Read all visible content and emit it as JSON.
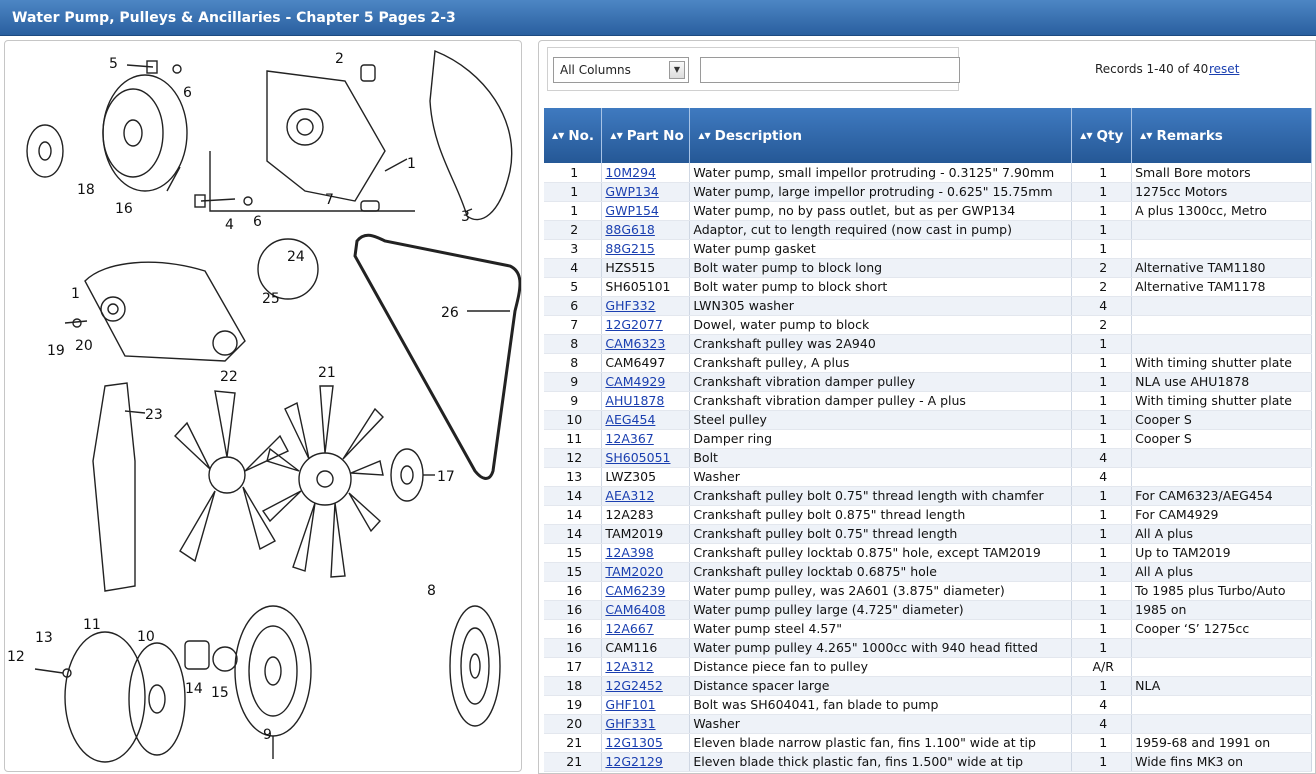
{
  "title": "Water Pump, Pulleys & Ancillaries - Chapter 5 Pages 2-3",
  "diagram": {
    "labels": [
      "5",
      "6",
      "2",
      "18",
      "16",
      "4",
      "6",
      "7",
      "1",
      "3",
      "24",
      "25",
      "1",
      "19",
      "20",
      "26",
      "22",
      "21",
      "23",
      "17",
      "8",
      "13",
      "11",
      "10",
      "12",
      "14",
      "15",
      "9"
    ]
  },
  "filter": {
    "column_select": "All Columns",
    "search_value": "",
    "records_text": "Records 1-40 of 40",
    "reset_label": "reset"
  },
  "table": {
    "headers": [
      "No.",
      "Part No",
      "Description",
      "Qty",
      "Remarks"
    ],
    "rows": [
      {
        "no": "1",
        "part": "10M294",
        "link": true,
        "desc": "Water pump, small impellor protruding - 0.3125\" 7.90mm",
        "qty": "1",
        "rem": "Small Bore motors"
      },
      {
        "no": "1",
        "part": "GWP134",
        "link": true,
        "desc": "Water pump, large impellor protruding - 0.625\" 15.75mm",
        "qty": "1",
        "rem": "1275cc Motors"
      },
      {
        "no": "1",
        "part": "GWP154",
        "link": true,
        "desc": "Water pump, no by pass outlet, but as per GWP134",
        "qty": "1",
        "rem": "A plus 1300cc, Metro"
      },
      {
        "no": "2",
        "part": "88G618",
        "link": true,
        "desc": "Adaptor, cut to length required (now cast in pump)",
        "qty": "1",
        "rem": ""
      },
      {
        "no": "3",
        "part": "88G215",
        "link": true,
        "desc": "Water pump gasket",
        "qty": "1",
        "rem": ""
      },
      {
        "no": "4",
        "part": "HZS515",
        "link": false,
        "desc": "Bolt water pump to block long",
        "qty": "2",
        "rem": "Alternative TAM1180"
      },
      {
        "no": "5",
        "part": "SH605101",
        "link": false,
        "desc": "Bolt water pump to block short",
        "qty": "2",
        "rem": "Alternative TAM1178"
      },
      {
        "no": "6",
        "part": "GHF332",
        "link": true,
        "desc": "LWN305 washer",
        "qty": "4",
        "rem": ""
      },
      {
        "no": "7",
        "part": "12G2077",
        "link": true,
        "desc": "Dowel, water pump to block",
        "qty": "2",
        "rem": ""
      },
      {
        "no": "8",
        "part": "CAM6323",
        "link": true,
        "desc": "Crankshaft pulley was 2A940",
        "qty": "1",
        "rem": ""
      },
      {
        "no": "8",
        "part": "CAM6497",
        "link": false,
        "desc": "Crankshaft pulley, A plus",
        "qty": "1",
        "rem": "With timing shutter plate"
      },
      {
        "no": "9",
        "part": "CAM4929",
        "link": true,
        "desc": "Crankshaft vibration damper pulley",
        "qty": "1",
        "rem": "NLA use AHU1878"
      },
      {
        "no": "9",
        "part": "AHU1878",
        "link": true,
        "desc": "Crankshaft vibration damper pulley - A plus",
        "qty": "1",
        "rem": "With timing shutter plate"
      },
      {
        "no": "10",
        "part": "AEG454",
        "link": true,
        "desc": "Steel pulley",
        "qty": "1",
        "rem": "Cooper S"
      },
      {
        "no": "11",
        "part": "12A367",
        "link": true,
        "desc": "Damper ring",
        "qty": "1",
        "rem": "Cooper S"
      },
      {
        "no": "12",
        "part": "SH605051",
        "link": true,
        "desc": "Bolt",
        "qty": "4",
        "rem": ""
      },
      {
        "no": "13",
        "part": "LWZ305",
        "link": false,
        "desc": "Washer",
        "qty": "4",
        "rem": ""
      },
      {
        "no": "14",
        "part": "AEA312",
        "link": true,
        "desc": "Crankshaft pulley bolt 0.75\" thread length with chamfer",
        "qty": "1",
        "rem": "For CAM6323/AEG454"
      },
      {
        "no": "14",
        "part": "12A283",
        "link": false,
        "desc": "Crankshaft pulley bolt 0.875\" thread length",
        "qty": "1",
        "rem": "For CAM4929"
      },
      {
        "no": "14",
        "part": "TAM2019",
        "link": false,
        "desc": "Crankshaft pulley bolt 0.75\" thread length",
        "qty": "1",
        "rem": "All A plus"
      },
      {
        "no": "15",
        "part": "12A398",
        "link": true,
        "desc": "Crankshaft pulley locktab 0.875\" hole, except TAM2019",
        "qty": "1",
        "rem": "Up to TAM2019"
      },
      {
        "no": "15",
        "part": "TAM2020",
        "link": true,
        "desc": "Crankshaft pulley locktab 0.6875\" hole",
        "qty": "1",
        "rem": "All A plus"
      },
      {
        "no": "16",
        "part": "CAM6239",
        "link": true,
        "desc": "Water pump pulley, was 2A601 (3.875\" diameter)",
        "qty": "1",
        "rem": "To 1985 plus Turbo/Auto"
      },
      {
        "no": "16",
        "part": "CAM6408",
        "link": true,
        "desc": "Water pump pulley large (4.725\" diameter)",
        "qty": "1",
        "rem": "1985 on"
      },
      {
        "no": "16",
        "part": "12A667",
        "link": true,
        "desc": "Water pump steel 4.57\"",
        "qty": "1",
        "rem": "Cooper ‘S’ 1275cc"
      },
      {
        "no": "16",
        "part": "CAM116",
        "link": false,
        "desc": "Water pump pulley 4.265\" 1000cc with 940 head fitted",
        "qty": "1",
        "rem": ""
      },
      {
        "no": "17",
        "part": "12A312",
        "link": true,
        "desc": "Distance piece fan to pulley",
        "qty": "A/R",
        "rem": ""
      },
      {
        "no": "18",
        "part": "12G2452",
        "link": true,
        "desc": "Distance spacer large",
        "qty": "1",
        "rem": "NLA"
      },
      {
        "no": "19",
        "part": "GHF101",
        "link": true,
        "desc": "Bolt was SH604041, fan blade to pump",
        "qty": "4",
        "rem": ""
      },
      {
        "no": "20",
        "part": "GHF331",
        "link": true,
        "desc": "Washer",
        "qty": "4",
        "rem": ""
      },
      {
        "no": "21",
        "part": "12G1305",
        "link": true,
        "desc": "Eleven blade narrow plastic fan, fins 1.100\" wide at tip",
        "qty": "1",
        "rem": "1959-68 and 1991 on"
      },
      {
        "no": "21",
        "part": "12G2129",
        "link": true,
        "desc": "Eleven blade thick plastic fan, fins 1.500\" wide at tip",
        "qty": "1",
        "rem": "Wide fins MK3 on"
      }
    ]
  }
}
